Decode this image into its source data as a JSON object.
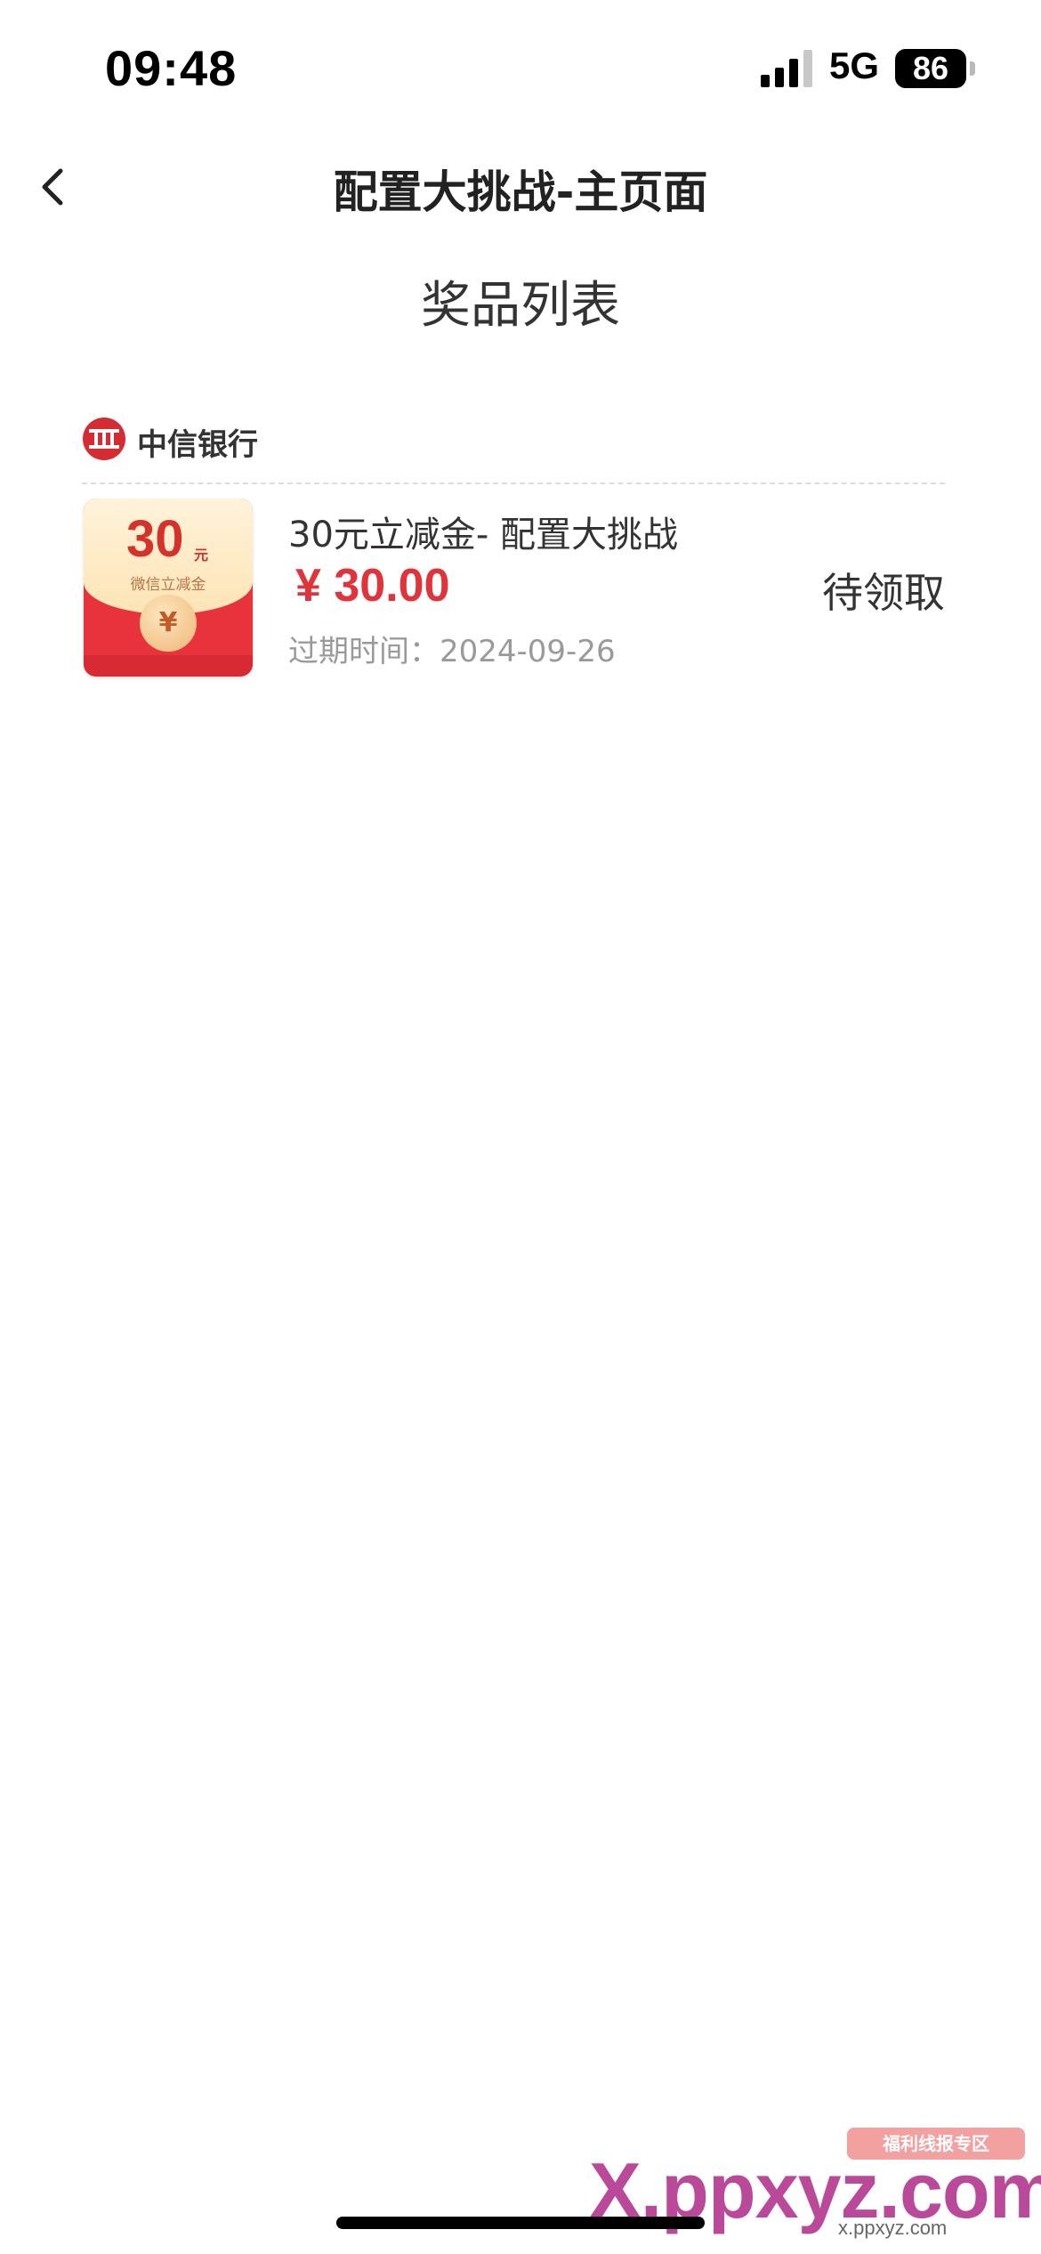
{
  "status_bar": {
    "time": "09:48",
    "network": "5G",
    "battery": "86"
  },
  "nav": {
    "title": "配置大挑战-主页面"
  },
  "section": {
    "title": "奖品列表"
  },
  "prizes": [
    {
      "bank_name": "中信银行",
      "coupon_amount": "30",
      "coupon_unit": "元",
      "coupon_subtitle": "微信立减金",
      "coupon_coin": "¥",
      "name": "30元立减金- 配置大挑战",
      "price": "¥ 30.00",
      "expire": "过期时间：2024-09-26",
      "status": "待领取"
    }
  ],
  "watermark": {
    "badge": "福利线报专区",
    "text": "X.ppxyz.com",
    "sub": "x.ppxyz.com"
  },
  "colors": {
    "price_red": "#e1333b",
    "bank_red": "#d52b32"
  }
}
